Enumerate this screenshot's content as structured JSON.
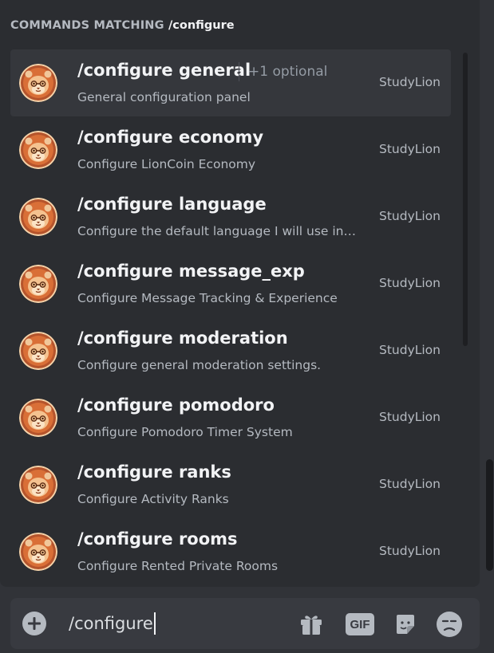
{
  "header": {
    "prefix": "COMMANDS MATCHING",
    "query": "/configure"
  },
  "commands": [
    {
      "name": "/configure general",
      "optional": "+1 optional",
      "description": "General configuration panel",
      "source": "StudyLion"
    },
    {
      "name": "/configure economy",
      "description": "Configure LionCoin Economy",
      "source": "StudyLion"
    },
    {
      "name": "/configure language",
      "description": "Configure the default language I will use in the server",
      "source": "StudyLion"
    },
    {
      "name": "/configure message_exp",
      "description": "Configure Message Tracking & Experience",
      "source": "StudyLion"
    },
    {
      "name": "/configure moderation",
      "description": "Configure general moderation settings.",
      "source": "StudyLion"
    },
    {
      "name": "/configure pomodoro",
      "description": "Configure Pomodoro Timer System",
      "source": "StudyLion"
    },
    {
      "name": "/configure ranks",
      "description": "Configure Activity Ranks",
      "source": "StudyLion"
    },
    {
      "name": "/configure rooms",
      "description": "Configure Rented Private Rooms",
      "source": "StudyLion"
    }
  ],
  "composer": {
    "value": "/configure",
    "gif_label": "GIF"
  },
  "icons": {
    "add": "plus-circle-icon",
    "gift": "gift-icon",
    "gif": "gif-icon",
    "sticker": "sticker-icon",
    "emoji": "emoji-icon"
  },
  "colors": {
    "background": "#313338",
    "popup": "#2b2d31",
    "selected": "#35373c",
    "composer": "#383a40"
  }
}
